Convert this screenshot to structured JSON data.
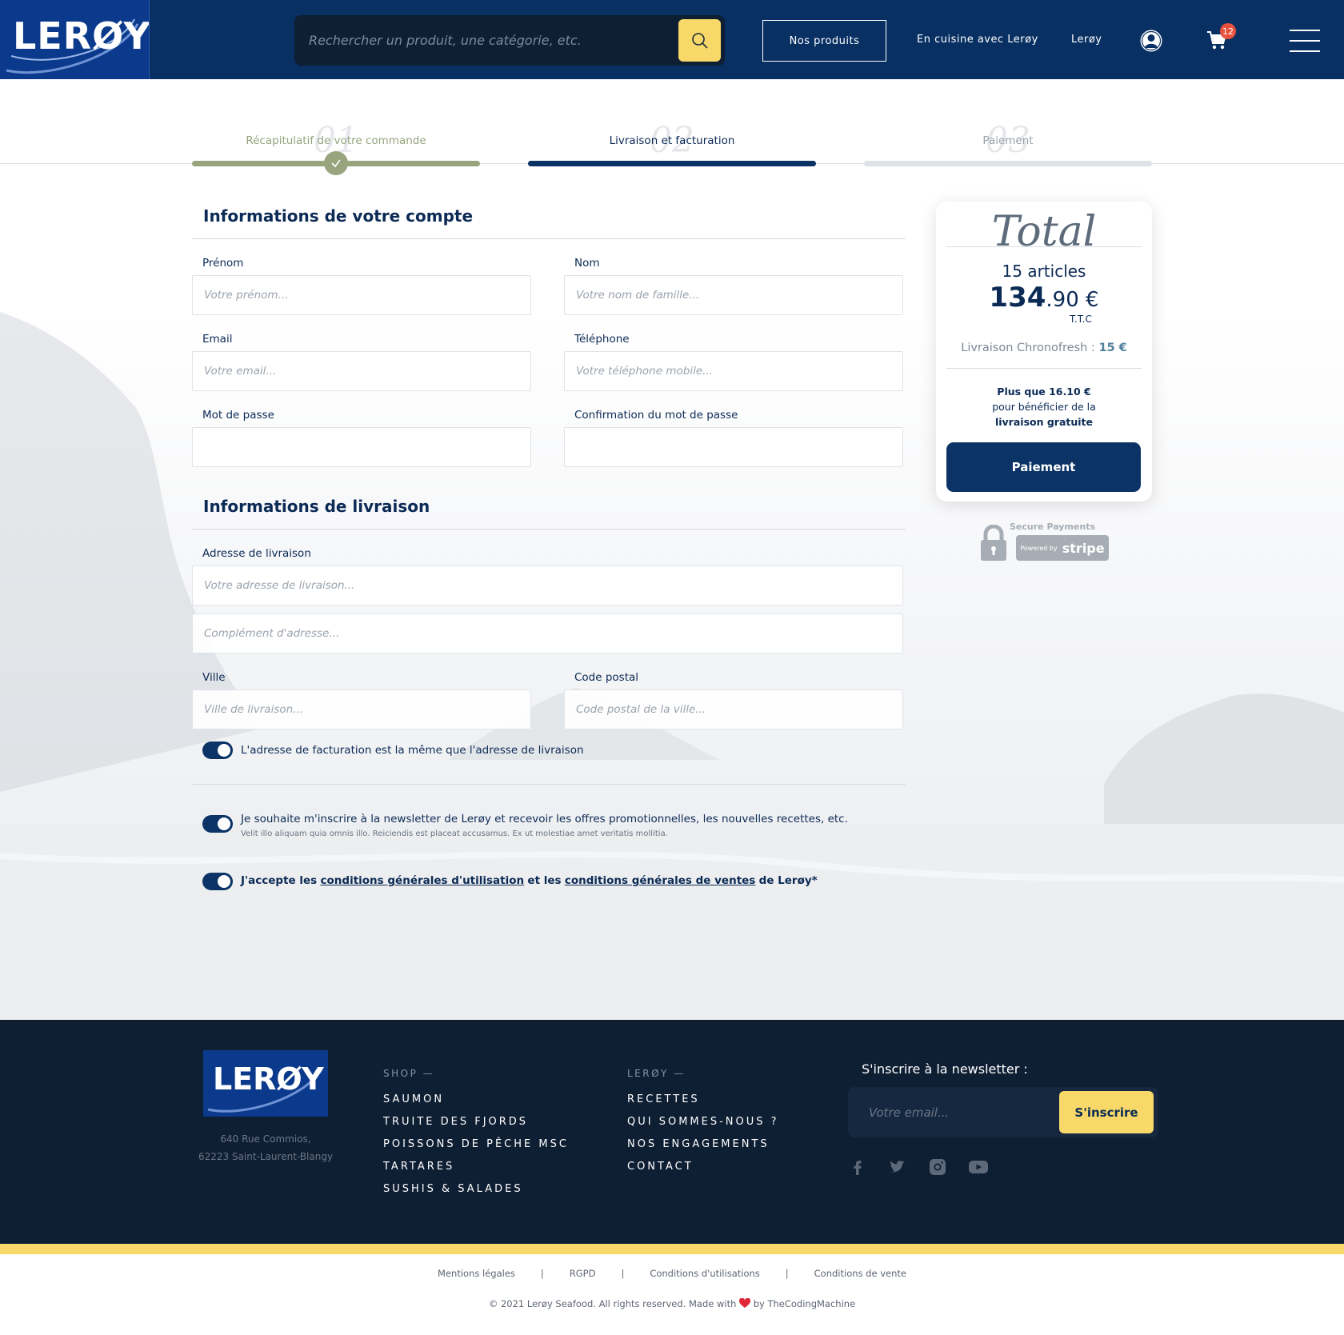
{
  "header": {
    "logo_text": "LERØY",
    "search_placeholder": "Rechercher un produit, une catégorie, etc.",
    "nav_products": "Nos produits",
    "nav_cooking": "En cuisine avec Lerøy",
    "nav_leroy": "Lerøy",
    "cart_count": "12",
    "icons": [
      "search-icon",
      "user-icon",
      "cart-icon",
      "menu-icon"
    ]
  },
  "stepper": {
    "steps": [
      {
        "num": "01",
        "label": "Récapitulatif de votre commande",
        "state": "done"
      },
      {
        "num": "02",
        "label": "Livraison et facturation",
        "state": "active"
      },
      {
        "num": "03",
        "label": "Paiement",
        "state": "todo"
      }
    ]
  },
  "account": {
    "title": "Informations de votre compte",
    "firstname_label": "Prénom",
    "firstname_placeholder": "Votre prénom...",
    "lastname_label": "Nom",
    "lastname_placeholder": "Votre nom de famille...",
    "email_label": "Email",
    "email_placeholder": "Votre email...",
    "phone_label": "Téléphone",
    "phone_placeholder": "Votre téléphone mobile...",
    "password_label": "Mot de passe",
    "password_confirm_label": "Confirmation du mot de passe"
  },
  "delivery": {
    "title": "Informations de livraison",
    "address_label": "Adresse de livraison",
    "address_placeholder": "Votre adresse de livraison...",
    "address2_placeholder": "Complément d'adresse...",
    "city_label": "Ville",
    "city_placeholder": "Ville de livraison...",
    "zip_label": "Code postal",
    "zip_placeholder": "Code postal de la ville...",
    "same_billing": "L'adresse de facturation est la même que l'adresse de livraison"
  },
  "consents": {
    "newsletter": "Je souhaite m'inscrire à la newsletter de Lerøy et recevoir les offres promotionnelles, les nouvelles recettes, etc.",
    "newsletter_sub": "Velit illo aliquam quia omnis illo. Reiciendis est placeat accusamus. Ex ut molestiae amet veritatis mollitia.",
    "terms_prefix": "J'accepte les",
    "terms_link1": "conditions générales d'utilisation",
    "terms_mid": "et les",
    "terms_link2": "conditions générales de ventes",
    "terms_suffix": "de Lerøy*"
  },
  "total": {
    "title": "Total",
    "articles": "15 articles",
    "price_int": "134",
    "price_dec": ".90 €",
    "ttc": "T.T.C",
    "delivery_label": "Livraison Chronofresh :",
    "delivery_price": "15 €",
    "free_line1": "Plus que 16.10 €",
    "free_line2": "pour bénéficier de la",
    "free_line3": "livraison gratuite",
    "pay_button": "Paiement",
    "secure_label": "Secure Payments",
    "powered_by": "Powered by",
    "stripe": "stripe"
  },
  "footer": {
    "logo_text": "LERØY",
    "address_line1": "640 Rue Commios,",
    "address_line2": "62223 Saint-Laurent-Blangy",
    "shop_title": "SHOP —",
    "shop_items": [
      "SAUMON",
      "TRUITE DES FJORDS",
      "POISSONS DE PÊCHE MSC",
      "TARTARES",
      "SUSHIS & SALADES"
    ],
    "leroy_title": "LERØY —",
    "leroy_items": [
      "RECETTES",
      "QUI SOMMES-NOUS ?",
      "NOS ENGAGEMENTS",
      "CONTACT"
    ],
    "newsletter_title": "S'inscrire à la newsletter :",
    "newsletter_placeholder": "Votre email...",
    "newsletter_button": "S'inscrire",
    "socials": [
      "facebook-icon",
      "twitter-icon",
      "instagram-icon",
      "youtube-icon"
    ]
  },
  "legal": {
    "links": [
      "Mentions légales",
      "RGPD",
      "Conditions d'utilisations",
      "Conditions de vente"
    ],
    "separator": "|",
    "copyright_prefix": "© 2021 Lerøy Seafood.  All rights reserved. Made with",
    "copyright_suffix": "by TheCodingMachine"
  },
  "colors": {
    "navy": "#083063",
    "accent_yellow": "#f7d868",
    "done_green": "#97a47e",
    "footer_dark": "#0e1e33",
    "badge_red": "#e8523c"
  }
}
